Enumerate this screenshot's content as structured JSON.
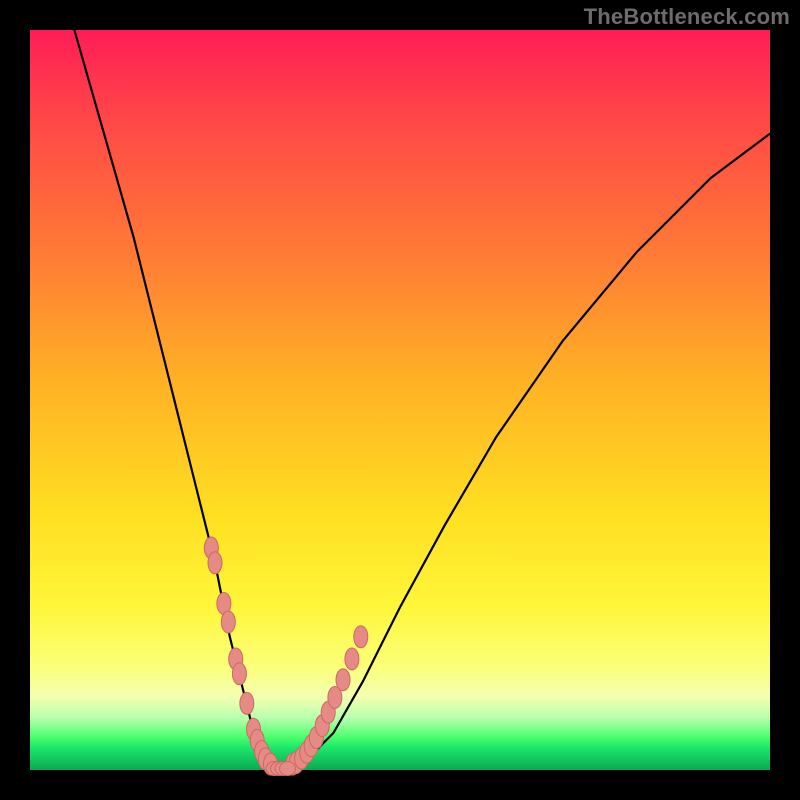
{
  "watermark": "TheBottleneck.com",
  "colors": {
    "frame": "#000000",
    "curve": "#000000",
    "marker_fill": "#e58a84",
    "marker_stroke": "#c96a63",
    "gradient_stops": [
      "#ff1d57",
      "#ff4747",
      "#ff7a36",
      "#ffb324",
      "#ffe022",
      "#fff63a",
      "#fbff7a",
      "#f4ffb0",
      "#b7ffad",
      "#4dff6d",
      "#1de66a",
      "#0aa953"
    ]
  },
  "chart_data": {
    "type": "line",
    "title": "",
    "xlabel": "",
    "ylabel": "",
    "xlim": [
      0,
      100
    ],
    "ylim": [
      0,
      100
    ],
    "curve": {
      "x": [
        6,
        10,
        14,
        18,
        20,
        22,
        24,
        25,
        26,
        27,
        28,
        29,
        30,
        31,
        32,
        33,
        34,
        36,
        38,
        41,
        45,
        50,
        56,
        63,
        72,
        82,
        92,
        100
      ],
      "y": [
        100,
        86,
        72,
        56,
        48,
        40,
        32,
        28,
        23,
        18,
        14,
        10,
        6,
        3,
        1,
        0,
        0,
        1,
        2,
        5,
        12,
        22,
        33,
        45,
        58,
        70,
        80,
        86
      ]
    },
    "left_branch_markers": {
      "x": [
        24.5,
        25.0,
        26.2,
        26.8,
        27.8,
        28.3,
        29.3,
        30.2,
        30.7,
        31.3,
        31.8,
        32.5
      ],
      "y": [
        30.0,
        28.0,
        22.5,
        20.0,
        15.0,
        13.0,
        9.0,
        5.5,
        4.0,
        2.5,
        1.5,
        0.8
      ]
    },
    "right_branch_markers": {
      "x": [
        35.5,
        36.0,
        36.7,
        37.4,
        38.0,
        38.7,
        39.5,
        40.3,
        41.2,
        42.3,
        43.5,
        44.7
      ],
      "y": [
        0.8,
        1.0,
        1.6,
        2.4,
        3.3,
        4.4,
        6.0,
        7.8,
        9.8,
        12.2,
        15.0,
        18.0
      ]
    },
    "bottom_markers": {
      "x": [
        33.0,
        33.6,
        34.2,
        34.8
      ],
      "y": [
        0.2,
        0.2,
        0.2,
        0.2
      ]
    }
  }
}
